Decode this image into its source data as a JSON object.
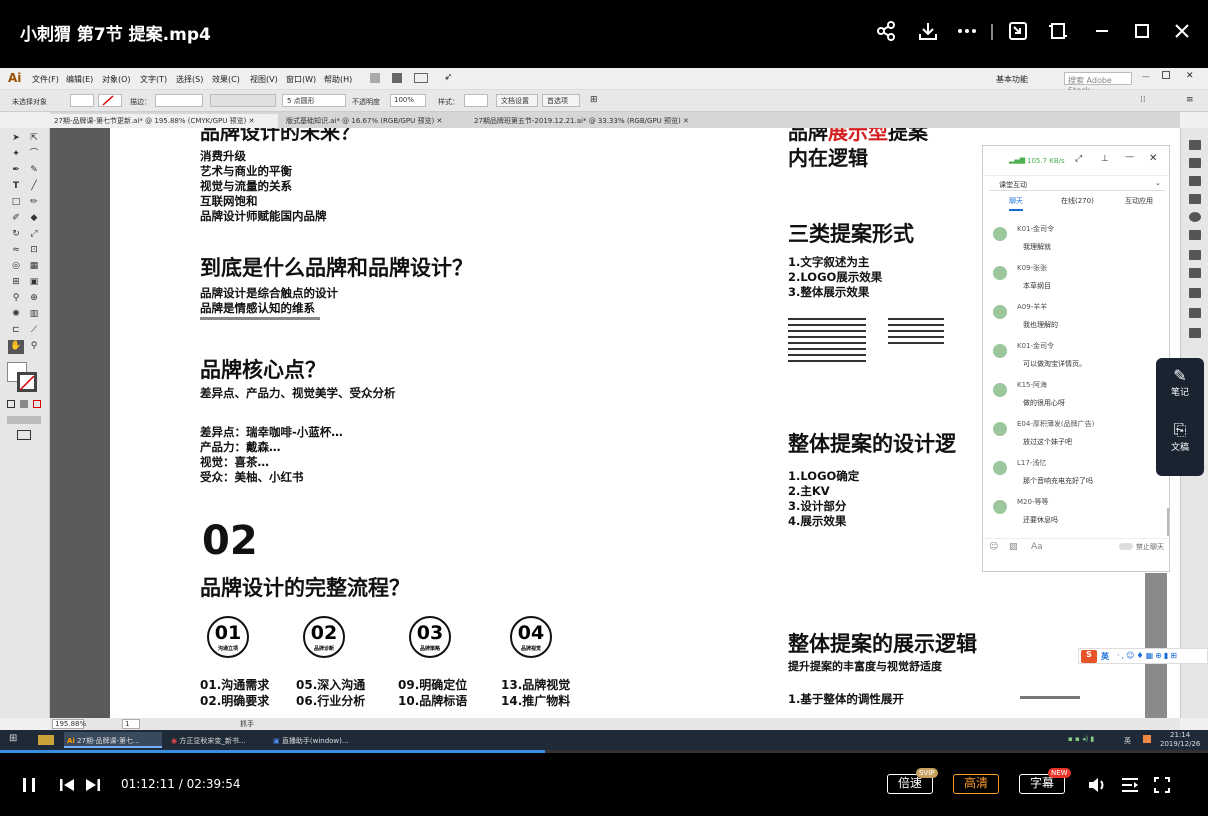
{
  "player": {
    "title": "小刺猬 第7节 提案.mp4",
    "time_current": "01:12:11",
    "time_total": "02:39:54",
    "time_sep": " / ",
    "progress": 0.451,
    "speed_label": "倍速",
    "speed_badge": "SVIP",
    "quality_label": "高清",
    "subtitle_label": "字幕",
    "subtitle_badge": "NEW",
    "accent": "#3a8ee6",
    "quality_color": "#ff9a2e"
  },
  "ai_app": {
    "logo": "Ai",
    "menu": [
      "文件(F)",
      "编辑(E)",
      "对象(O)",
      "文字(T)",
      "选择(S)",
      "效果(C)",
      "视图(V)",
      "窗口(W)",
      "帮助(H)"
    ],
    "workspace": "基本功能",
    "search_placeholder": "搜索 Adobe Stock",
    "no_selection": "未选择对象",
    "stroke_label": "描边：",
    "opacity_label": "不透明度",
    "opacity_value": "100%",
    "style_label": "样式：",
    "doc_setup": "文档设置",
    "prefs": "首选项",
    "pt_label": "5 点圆形",
    "tabs": [
      "27期-品牌课-第七节更新.ai* @ 195.88% (CMYK/GPU 预览)",
      "版式基础知识.ai* @ 16.67% (RGB/GPU 预览)",
      "27期品牌班第五节-2019.12.21.ai* @ 33.33% (RGB/GPU 预览)"
    ],
    "zoom": "195.88%",
    "page": "1",
    "status_tool": "抓手"
  },
  "slide_left": {
    "heading_top": "品牌设计的未来？",
    "list1": [
      "消费升级",
      "艺术与商业的平衡",
      "视觉与流量的关系",
      "互联网饱和",
      "品牌设计师赋能国内品牌"
    ],
    "h2": "到底是什么品牌和品牌设计？",
    "list2": [
      "品牌设计是综合触点的设计",
      "品牌是情感认知的维系"
    ],
    "h3": "品牌核心点？",
    "sub3": "差异点、产品力、视觉美学、受众分析",
    "list3": [
      "差异点：瑞幸咖啡-小蓝杯…",
      "产品力：戴森…",
      "视觉：喜茶…",
      "受众：美柚、小红书"
    ],
    "num": "02",
    "h4": "品牌设计的完整流程？",
    "circles": [
      {
        "num": "01",
        "label": "沟通立项"
      },
      {
        "num": "02",
        "label": "品牌诊断"
      },
      {
        "num": "03",
        "label": "品牌策略"
      },
      {
        "num": "04",
        "label": "品牌视觉"
      }
    ],
    "steps": [
      [
        "01.沟通需求",
        "02.明确要求"
      ],
      [
        "05.深入沟通",
        "06.行业分析"
      ],
      [
        "09.明确定位",
        "10.品牌标语"
      ],
      [
        "13.品牌视觉",
        "14.推广物料"
      ]
    ]
  },
  "slide_right": {
    "h1a": "品牌",
    "h1b": "展示型",
    "h1c": "提案",
    "h1d": "内在逻辑",
    "h2": "三类提案形式",
    "list2": [
      "1.文字叙述为主",
      "2.LOGO展示效果",
      "3.整体展示效果"
    ],
    "h3": "整体提案的设计逻",
    "list3": [
      "1.LOGO确定",
      "2.主KV",
      "3.设计部分",
      "4.展示效果"
    ],
    "h4": "整体提案的展示逻辑",
    "sub4": "提升提案的丰富度与视觉舒适度",
    "item4": "1.基于整体的调性展开",
    "highlight_color": "#d42020"
  },
  "chat": {
    "speed": "105.7 KB/s",
    "dropdown": "课堂互动",
    "tabs": [
      "聊天",
      "在线(270)",
      "互动应用"
    ],
    "messages": [
      {
        "name": "K01-金司令",
        "text": "我理解就"
      },
      {
        "name": "K09-张张",
        "text": "本草纲目"
      },
      {
        "name": "A09-羊羊",
        "text": "我也理解的"
      },
      {
        "name": "K01-金司令",
        "text": "可以做淘宝详情页。"
      },
      {
        "name": "K15-阿海",
        "text": "做的很用心呀"
      },
      {
        "name": "E04-厚积薄发(品牌广告)",
        "text": "放过这个妹子吧"
      },
      {
        "name": "L17-浅忆",
        "text": "那个音响充电充好了吗"
      },
      {
        "name": "M20-等等",
        "text": "还要休息吗"
      }
    ],
    "mute": "禁止聊天"
  },
  "side_widget": {
    "note": "笔记",
    "doc": "文稿"
  },
  "ime": {
    "label": "英"
  },
  "taskbar": {
    "items": [
      "27期-品牌课-第七...",
      "方正显秋宋变_新书...",
      "直播助手(window)..."
    ],
    "time": "21:14",
    "date": "2019/12/26",
    "lang": "英"
  }
}
